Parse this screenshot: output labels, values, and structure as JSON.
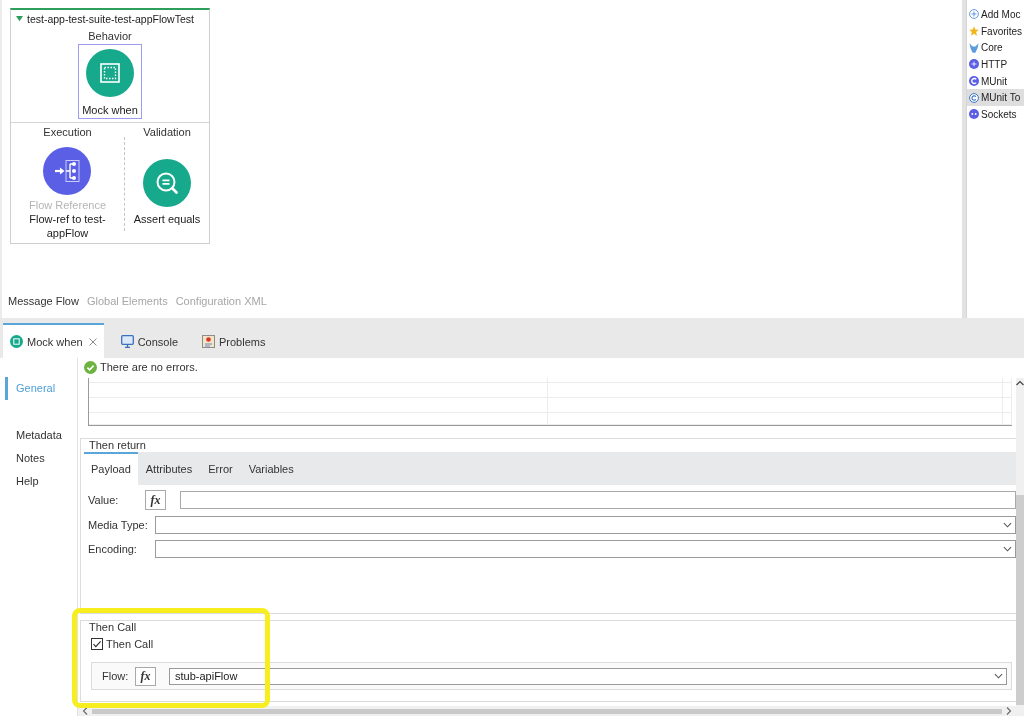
{
  "canvas": {
    "container": {
      "title": "test-app-test-suite-test-appFlowTest",
      "expanded": true,
      "sections": [
        {
          "label": "Behavior",
          "processors": [
            {
              "kind": "mock",
              "name": "Mock when",
              "selected": true
            }
          ]
        },
        {
          "label": "Execution",
          "processors": [
            {
              "kind": "flow-ref",
              "type": "Flow Reference",
              "name": "Flow-ref to test-appFlow",
              "selected": false
            }
          ]
        },
        {
          "label": "Validation",
          "processors": [
            {
              "kind": "assert",
              "name": "Assert equals",
              "selected": false
            }
          ]
        }
      ]
    },
    "editor_tabs": [
      {
        "label": "Message Flow",
        "selected": true
      },
      {
        "label": "Global Elements",
        "selected": false
      },
      {
        "label": "Configuration XML",
        "selected": false
      }
    ]
  },
  "palette": {
    "items": [
      {
        "kind": "add",
        "label": "Add Moc",
        "selected": false
      },
      {
        "kind": "favorites",
        "label": "Favorites",
        "selected": false
      },
      {
        "kind": "core",
        "label": "Core",
        "selected": false
      },
      {
        "kind": "http",
        "label": "HTTP",
        "selected": false
      },
      {
        "kind": "munit",
        "label": "MUnit",
        "selected": false
      },
      {
        "kind": "munit-tools",
        "label": "MUnit To",
        "selected": true
      },
      {
        "kind": "sockets",
        "label": "Sockets",
        "selected": false
      }
    ]
  },
  "properties_panel": {
    "tabs": [
      {
        "kind": "mock",
        "label": "Mock when",
        "selected": true,
        "closable": true
      },
      {
        "kind": "console",
        "label": "Console",
        "selected": false,
        "closable": false
      },
      {
        "kind": "problems",
        "label": "Problems",
        "selected": false,
        "closable": false
      }
    ],
    "nav": [
      {
        "label": "General",
        "selected": true
      },
      {
        "label": "Metadata",
        "selected": false
      },
      {
        "label": "Notes",
        "selected": false
      },
      {
        "label": "Help",
        "selected": false
      }
    ],
    "status": {
      "kind": "ok",
      "text": "There are no errors."
    },
    "then_return": {
      "title": "Then return",
      "tabs": [
        {
          "label": "Payload",
          "selected": true
        },
        {
          "label": "Attributes",
          "selected": false
        },
        {
          "label": "Error",
          "selected": false
        },
        {
          "label": "Variables",
          "selected": false
        }
      ],
      "fields": [
        {
          "kind": "expression",
          "label": "Value:",
          "button": "fx"
        },
        {
          "kind": "combo",
          "label": "Media Type:"
        },
        {
          "kind": "combo",
          "label": "Encoding:"
        }
      ]
    },
    "then_call": {
      "title": "Then Call",
      "checkbox": {
        "label": "Then Call",
        "checked": true
      },
      "flow": {
        "label": "Flow:",
        "button": "fx",
        "value": "stub-apiFlow"
      }
    }
  }
}
